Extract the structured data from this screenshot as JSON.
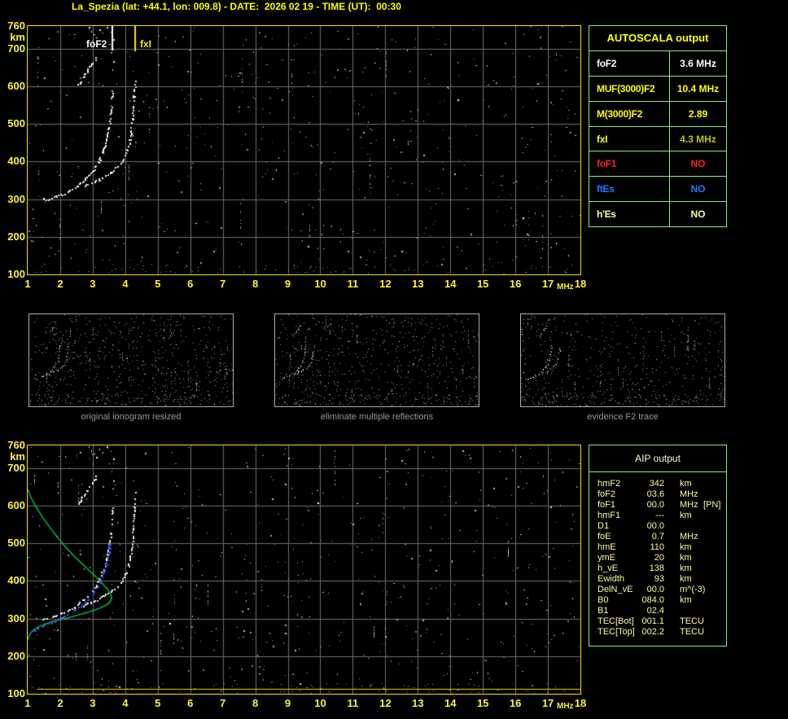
{
  "title": "La_Spezia (lat: +44.1, lon: 009.8) - DATE:  2026 02 19 - TIME (UT):  00:30",
  "colors": {
    "background": "#000000",
    "title_yellow": "#FFFF00",
    "axis_yellow": "#FFF23C",
    "plot_border": "#F2E000",
    "grid_gray": "#6F6F6F",
    "table_border_green": "#8DE88D",
    "trace_white": "#FFFFFF",
    "profile_green": "#00C841",
    "restored_trace_blue": "#3344FF",
    "fxI_olive": "#C2C200",
    "foF1_red": "#FF2020",
    "ftEs_blue": "#1E78FF",
    "pale_yellow": "#FFFA9E",
    "caption_gray": "#989898"
  },
  "axes": {
    "x_unit": "MHz",
    "y_unit": "km",
    "x_ticks": [
      1,
      2,
      3,
      4,
      5,
      6,
      7,
      8,
      9,
      10,
      11,
      12,
      13,
      14,
      15,
      16,
      17,
      18
    ],
    "y_ticks": [
      760,
      700,
      600,
      500,
      400,
      300,
      200,
      100
    ]
  },
  "top_chart": {
    "foF2_label": "foF2",
    "fxI_label": "fxI"
  },
  "autoscala_table": {
    "header": "AUTOSCALA output",
    "rows": [
      {
        "label": "foF2",
        "value": "3.6 MHz",
        "label_color": "#FFFFFF",
        "value_color": "#FFFFFF"
      },
      {
        "label": "MUF(3000)F2",
        "value": "10.4 MHz",
        "label_color": "#FFFF00",
        "value_color": "#FFFF00"
      },
      {
        "label": "M(3000)F2",
        "value": "2.89",
        "label_color": "#FFFF00",
        "value_color": "#FFFF00"
      },
      {
        "label": "fxI",
        "value": "4.3 MHz",
        "label_color": "#FFFF00",
        "value_color": "#C2C200"
      },
      {
        "label": "foF1",
        "value": "NO",
        "label_color": "#FF2020",
        "value_color": "#FF2020"
      },
      {
        "label": "ftEs",
        "value": "NO",
        "label_color": "#1E78FF",
        "value_color": "#1E78FF"
      },
      {
        "label": "h'Es",
        "value": "NO",
        "label_color": "#FFFA9E",
        "value_color": "#FFFA9E"
      }
    ]
  },
  "aip_table": {
    "header": "AIP output",
    "rows": [
      {
        "label": "hmF2",
        "value": "342",
        "unit": "km",
        "extra": ""
      },
      {
        "label": "foF2",
        "value": "03.6",
        "unit": "MHz",
        "extra": ""
      },
      {
        "label": "foF1",
        "value": "00.0",
        "unit": "MHz",
        "extra": "[PN]"
      },
      {
        "label": "hmF1",
        "value": "---",
        "unit": "km",
        "extra": ""
      },
      {
        "label": "D1",
        "value": "00.0",
        "unit": "",
        "extra": ""
      },
      {
        "label": "foE",
        "value": "0.7",
        "unit": "MHz",
        "extra": ""
      },
      {
        "label": "hmE",
        "value": "110",
        "unit": "km",
        "extra": ""
      },
      {
        "label": "ymE",
        "value": "20",
        "unit": "km",
        "extra": ""
      },
      {
        "label": "h_vE",
        "value": "138",
        "unit": "km",
        "extra": ""
      },
      {
        "label": "Ewidth",
        "value": "93",
        "unit": "km",
        "extra": ""
      },
      {
        "label": "DelN_vE",
        "value": "00.0",
        "unit": "m^(-3)",
        "extra": ""
      },
      {
        "label": "B0",
        "value": "084.0",
        "unit": "km",
        "extra": ""
      },
      {
        "label": "B1",
        "value": "02.4",
        "unit": "",
        "extra": ""
      },
      {
        "label": "TEC[Bot]",
        "value": "001.1",
        "unit": "TECU",
        "extra": ""
      },
      {
        "label": "TEC[Top]",
        "value": "002.2",
        "unit": "TECU",
        "extra": ""
      }
    ]
  },
  "panel_captions": [
    "original ionogram resized",
    "eliminate multiple reflections",
    "evidence F2 trace"
  ],
  "chart_data": [
    {
      "type": "scatter",
      "title": "top ionogram with AUTOSCALA markers",
      "xlabel": "MHz",
      "ylabel": "km",
      "xlim": [
        1,
        18
      ],
      "ylim": [
        100,
        760
      ],
      "grid": true,
      "markers": {
        "foF2_MHz": 3.6,
        "fxI_MHz": 4.3,
        "marker_line_top_km": 760,
        "marker_line_bottom_km": 695
      },
      "series": [
        {
          "name": "O-mode trace",
          "points": [
            [
              1.45,
              300
            ],
            [
              1.6,
              302
            ],
            [
              1.8,
              307
            ],
            [
              2.0,
              313
            ],
            [
              2.2,
              320
            ],
            [
              2.4,
              329
            ],
            [
              2.55,
              339
            ],
            [
              2.7,
              351
            ],
            [
              2.85,
              364
            ],
            [
              3.0,
              377
            ],
            [
              3.1,
              390
            ],
            [
              3.2,
              406
            ],
            [
              3.3,
              428
            ],
            [
              3.38,
              450
            ],
            [
              3.44,
              472
            ],
            [
              3.48,
              494
            ],
            [
              3.52,
              515
            ],
            [
              3.55,
              535
            ],
            [
              3.57,
              552
            ]
          ]
        },
        {
          "name": "O-mode asymptote dashes",
          "points": [
            [
              3.57,
              560
            ],
            [
              3.58,
              575
            ],
            [
              3.585,
              590
            ],
            [
              3.59,
              602
            ]
          ]
        },
        {
          "name": "X-mode trace",
          "points": [
            [
              2.6,
              331
            ],
            [
              2.8,
              339
            ],
            [
              3.0,
              347
            ],
            [
              3.2,
              355
            ],
            [
              3.4,
              364
            ],
            [
              3.6,
              375
            ],
            [
              3.75,
              387
            ],
            [
              3.9,
              402
            ],
            [
              4.0,
              419
            ],
            [
              4.08,
              439
            ],
            [
              4.14,
              461
            ],
            [
              4.18,
              484
            ],
            [
              4.21,
              508
            ],
            [
              4.23,
              532
            ],
            [
              4.24,
              553
            ]
          ]
        },
        {
          "name": "X-mode asymptote dashes",
          "points": [
            [
              4.25,
              562
            ],
            [
              4.26,
              575
            ],
            [
              4.27,
              590
            ],
            [
              4.28,
              608
            ],
            [
              4.285,
              622
            ],
            [
              4.29,
              641
            ]
          ]
        },
        {
          "name": "second reflection",
          "points": [
            [
              2.5,
              600
            ],
            [
              2.58,
              610
            ],
            [
              2.66,
              621
            ],
            [
              2.74,
              632
            ],
            [
              2.82,
              643
            ],
            [
              2.9,
              653
            ],
            [
              2.98,
              663
            ],
            [
              3.06,
              673
            ],
            [
              3.13,
              682
            ]
          ]
        },
        {
          "name": "upper specks",
          "points": [
            [
              2.88,
              757
            ],
            [
              2.95,
              747
            ],
            [
              3.02,
              738
            ],
            [
              3.1,
              729
            ],
            [
              3.2,
              752
            ],
            [
              3.3,
              742
            ],
            [
              3.42,
              757
            ],
            [
              3.5,
              712
            ],
            [
              3.56,
              745
            ],
            [
              3.6,
              700
            ],
            [
              3.6,
              645
            ],
            [
              3.62,
              668
            ],
            [
              3.58,
              690
            ],
            [
              3.64,
              725
            ]
          ]
        }
      ]
    },
    {
      "type": "scatter",
      "title": "bottom ionogram with AIP profile",
      "xlabel": "MHz",
      "ylabel": "km",
      "xlim": [
        1,
        18
      ],
      "ylim": [
        100,
        760
      ],
      "grid": true,
      "e_layer_line_km": 113,
      "series": [
        {
          "name": "electron density profile (green)",
          "points": [
            [
              1.0,
              643
            ],
            [
              1.1,
              622
            ],
            [
              1.25,
              598
            ],
            [
              1.45,
              570
            ],
            [
              1.7,
              540
            ],
            [
              1.95,
              512
            ],
            [
              2.2,
              487
            ],
            [
              2.45,
              464
            ],
            [
              2.7,
              443
            ],
            [
              2.95,
              423
            ],
            [
              3.15,
              406
            ],
            [
              3.32,
              391
            ],
            [
              3.45,
              378
            ],
            [
              3.54,
              367
            ],
            [
              3.58,
              358
            ],
            [
              3.57,
              350
            ],
            [
              3.5,
              341
            ],
            [
              3.38,
              334
            ],
            [
              3.2,
              327
            ],
            [
              3.0,
              321
            ],
            [
              2.75,
              314
            ],
            [
              2.5,
              308
            ],
            [
              2.25,
              302
            ],
            [
              2.0,
              297
            ],
            [
              1.75,
              291
            ],
            [
              1.5,
              284
            ],
            [
              1.3,
              276
            ],
            [
              1.15,
              267
            ],
            [
              1.05,
              256
            ],
            [
              1.0,
              243
            ]
          ]
        },
        {
          "name": "restored O-trace (blue)",
          "points": [
            [
              1.02,
              262
            ],
            [
              1.15,
              268
            ],
            [
              1.3,
              274
            ],
            [
              1.5,
              282
            ],
            [
              1.7,
              290
            ],
            [
              1.9,
              298
            ],
            [
              2.1,
              307
            ],
            [
              2.3,
              316
            ],
            [
              2.5,
              327
            ],
            [
              2.7,
              340
            ],
            [
              2.85,
              352
            ],
            [
              3.0,
              367
            ],
            [
              3.1,
              380
            ],
            [
              3.2,
              396
            ],
            [
              3.3,
              416
            ],
            [
              3.38,
              437
            ],
            [
              3.44,
              458
            ],
            [
              3.48,
              478
            ],
            [
              3.51,
              497
            ],
            [
              3.53,
              510
            ]
          ]
        },
        {
          "name": "isolated blue point",
          "points": [
            [
              3.65,
              605
            ]
          ]
        }
      ]
    }
  ]
}
